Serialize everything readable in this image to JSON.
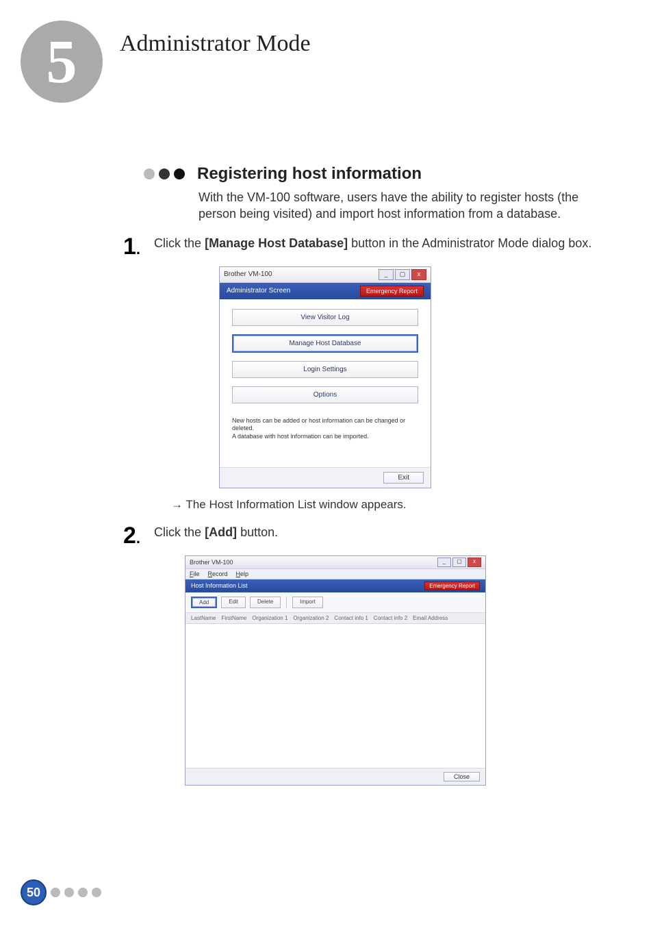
{
  "chapter": {
    "number": "5",
    "title": "Administrator Mode"
  },
  "section": {
    "heading": "Registering host information",
    "body": "With the VM-100 software, users have the ability to register hosts (the person being visited) and import host information from a database."
  },
  "steps": {
    "s1_num": "1",
    "s1_dot": ".",
    "s1_pre": "Click the ",
    "s1_bold": "[Manage Host Database]",
    "s1_post": " button in the Administrator Mode dialog box.",
    "s1_result": "The Host Information List window appears.",
    "s2_num": "2",
    "s2_dot": ".",
    "s2_pre": "Click the ",
    "s2_bold": "[Add]",
    "s2_post": " button."
  },
  "dlg1": {
    "winTitle": "Brother VM-100",
    "screenLabel": "Administrator Screen",
    "emergency": "Emergency Report",
    "btn1": "View Visitor Log",
    "btn2": "Manage Host Database",
    "btn3": "Login Settings",
    "btn4": "Options",
    "msg1": "New hosts can be added or host information can be changed or deleted.",
    "msg2": "A database with host information can be imported.",
    "exit": "Exit"
  },
  "dlg2": {
    "winTitle": "Brother VM-100",
    "menuFile": "File",
    "menuRecord": "Record",
    "menuHelp": "Help",
    "screenLabel": "Host Information List",
    "emergency": "Emergency Report",
    "btnAdd": "Add",
    "btnEdit": "Edit",
    "btnDelete": "Delete",
    "btnImport": "Import",
    "col1": "LastName",
    "col2": "FirstName",
    "col3": "Organization 1",
    "col4": "Organization 2",
    "col5": "Contact info 1",
    "col6": "Contact info 2",
    "col7": "Email Address",
    "close": "Close"
  },
  "footer": {
    "pageNumber": "50"
  },
  "resultArrow": "→"
}
